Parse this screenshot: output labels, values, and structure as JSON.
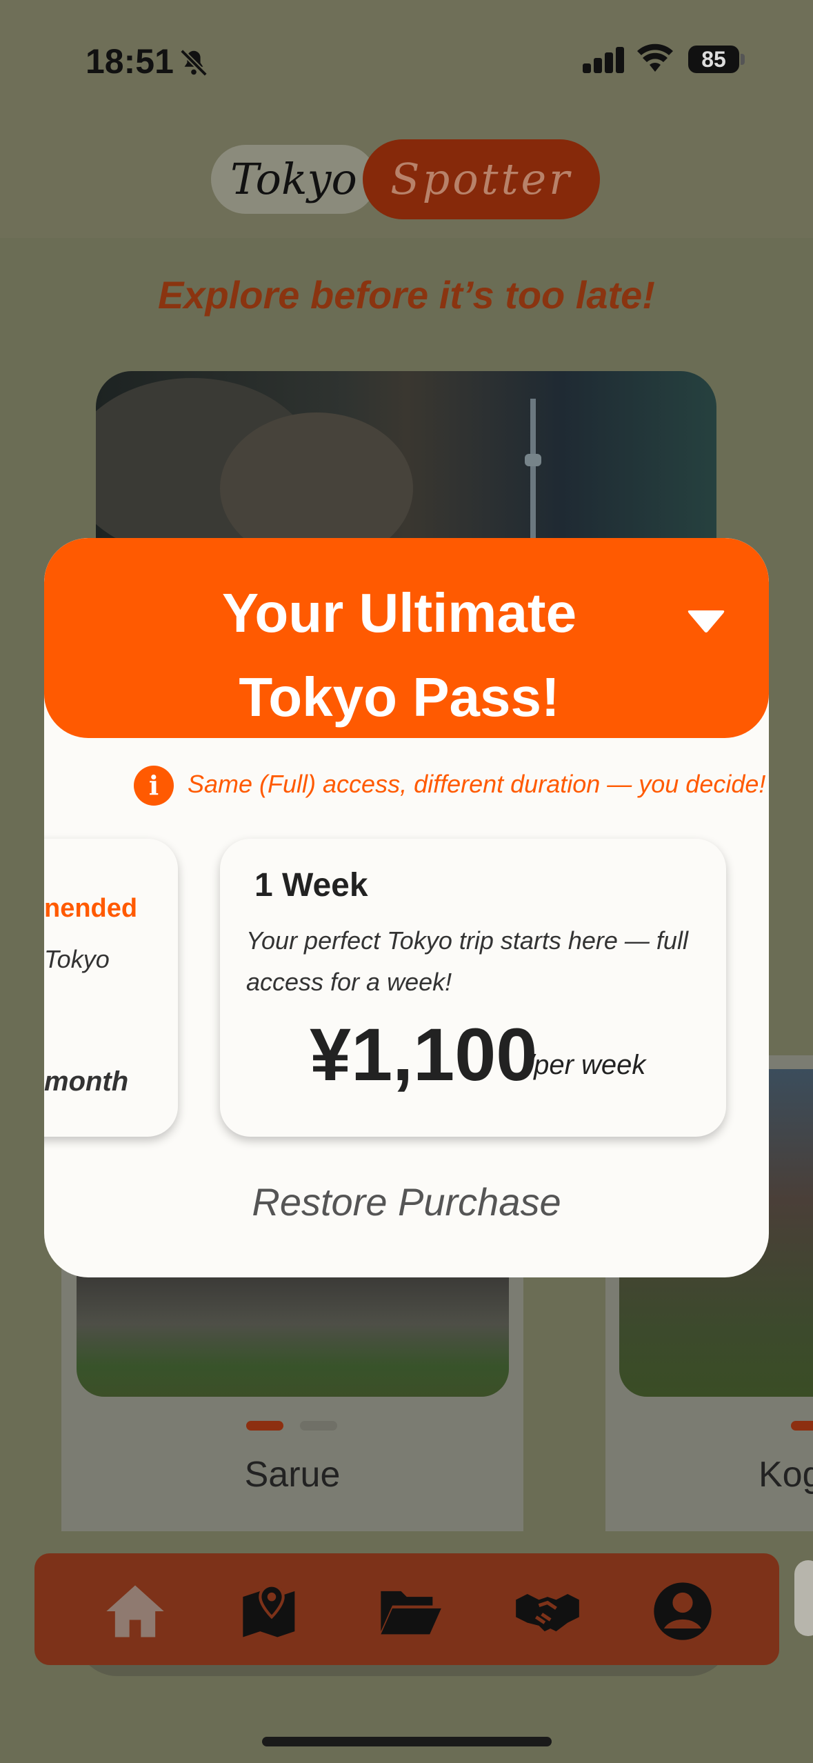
{
  "status_bar": {
    "time": "18:51",
    "battery": "85",
    "icons": [
      "bell-slash-icon",
      "signal-icon",
      "wifi-icon",
      "battery-icon"
    ]
  },
  "header": {
    "logo_part1": "Tokyo",
    "logo_part2": "Spotter",
    "tagline": "Explore before it’s too late!"
  },
  "background_cards": {
    "sarue_title": "Sarue",
    "kog_title": "Kog"
  },
  "modal": {
    "title_line1": "Your Ultimate",
    "title_line2": "Tokyo Pass!",
    "info_text": "Same (Full) access, different duration — you decide!",
    "plans": {
      "month": {
        "badge": "nended",
        "desc": "Tokyo",
        "per": "month"
      },
      "week": {
        "title": "1 Week",
        "desc": "Your perfect Tokyo trip starts here — full access for a week!",
        "price": "¥1,100",
        "per": "/per week"
      }
    },
    "restore": "Restore Purchase"
  },
  "nav": {
    "items": [
      "home-icon",
      "map-icon",
      "folder-icon",
      "handshake-icon",
      "profile-icon"
    ]
  },
  "colors": {
    "accent": "#ff5a01",
    "overlay_bg": "#6b6d55",
    "modal_bg": "#fcfbf8"
  }
}
